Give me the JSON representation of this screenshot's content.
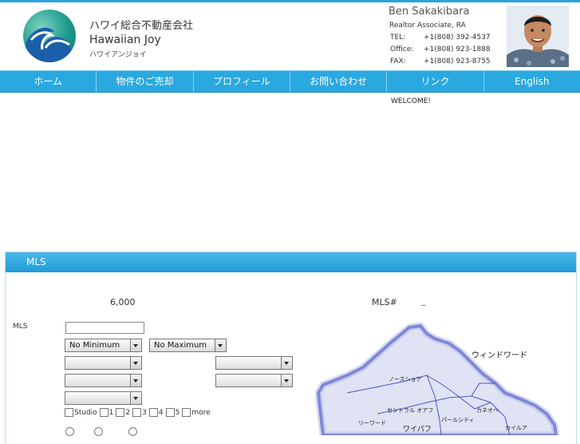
{
  "header": {
    "company_jp": "ハワイ総合不動産会社",
    "company_en": "Hawaiian Joy",
    "company_kana": "ハワイアンジョイ",
    "agent_name": "Ben Sakakibara",
    "agent_title": "Realtor Associate, RA",
    "contacts": [
      {
        "label": "TEL:",
        "value": "+1(808) 392-4537"
      },
      {
        "label": "Office:",
        "value": "+1(808) 923-1888"
      },
      {
        "label": "FAX:",
        "value": "+1(808) 923-8755"
      }
    ]
  },
  "nav": {
    "items": [
      {
        "label": "ホーム"
      },
      {
        "label": "物件のご売却"
      },
      {
        "label": "プロフィール"
      },
      {
        "label": "お問い合わせ"
      },
      {
        "label": "リンク"
      },
      {
        "label": "English"
      }
    ]
  },
  "welcome": "WELCOME!",
  "mls": {
    "title": "MLS",
    "count": "6,000",
    "mls_number_label": "MLS#",
    "mls_number_link": "_",
    "search_label": "MLS",
    "search_value": "",
    "min_price": "No Minimum",
    "max_price": "No Maximum",
    "beds": [
      "Studio",
      "1",
      "2",
      "3",
      "4",
      "5",
      "more"
    ]
  },
  "map": {
    "regions": [
      "ウィンドワード",
      "ノースショア",
      "セントラル オアフ",
      "カネオヘ",
      "パールシティ",
      "カイルア",
      "リーワード",
      "ワイパフ"
    ]
  },
  "colors": {
    "nav": "#2aa8e0",
    "accent": "#29a3dd",
    "map_land": "#dfe3f3",
    "map_outline": "#4a56c8"
  },
  "icons": {
    "logo": "wave-logo-icon",
    "select_arrow": "dropdown-arrow-icon"
  }
}
